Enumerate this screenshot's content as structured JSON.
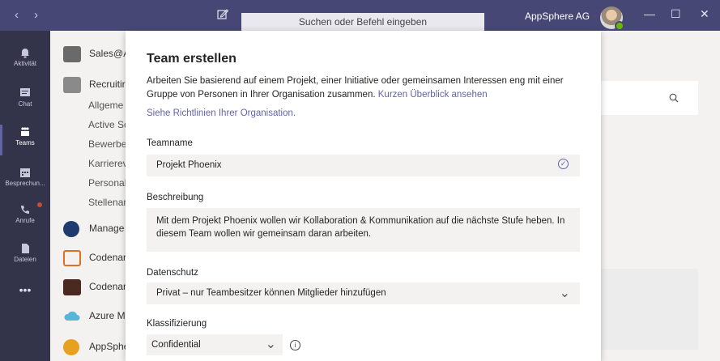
{
  "titlebar": {
    "back": "‹",
    "forward": "›",
    "search_placeholder": "Suchen oder Befehl eingeben",
    "org_name": "AppSphere AG",
    "org_chevron": "⌄",
    "minimize": "—",
    "maximize": "☐",
    "close": "✕"
  },
  "rail": {
    "items": [
      {
        "label": "Aktivität",
        "icon": "bell-icon"
      },
      {
        "label": "Chat",
        "icon": "chat-icon"
      },
      {
        "label": "Teams",
        "icon": "teams-icon"
      },
      {
        "label": "Besprechun...",
        "icon": "calendar-icon"
      },
      {
        "label": "Anrufe",
        "icon": "phone-icon"
      },
      {
        "label": "Dateien",
        "icon": "files-icon"
      },
      {
        "label": "•••",
        "icon": "more-icon"
      }
    ]
  },
  "teams_list": {
    "teams": [
      {
        "name": "Sales@A",
        "icon": "sales-team-icon"
      },
      {
        "name": "Recruitir",
        "icon": "recruiting-team-icon"
      },
      {
        "name": "Manage",
        "icon": "management-team-icon"
      },
      {
        "name": "Codenar",
        "icon": "codename-team-icon"
      },
      {
        "name": "Codenar",
        "icon": "codename2-team-icon"
      },
      {
        "name": "Azure M",
        "icon": "azure-team-icon"
      },
      {
        "name": "AppSphe",
        "icon": "appsphere-team-icon"
      }
    ],
    "channels": [
      "Allgeme",
      "Active Sc",
      "Bewerbe",
      "Karrierev",
      "Personal",
      "Stellenar"
    ]
  },
  "modal": {
    "title": "Team erstellen",
    "intro": "Arbeiten Sie basierend auf einem Projekt, einer Initiative oder gemeinsamen Interessen eng mit einer Gruppe von Personen in Ihrer Organisation zusammen.",
    "intro_link": "Kurzen Überblick ansehen",
    "policy_link": "Siehe Richtlinien Ihrer Organisation.",
    "teamname_label": "Teamname",
    "teamname_value": "Projekt Phoenix",
    "description_label": "Beschreibung",
    "description_value": "Mit dem Projekt Phoenix wollen wir Kollaboration & Kommunikation auf die nächste Stufe heben. In diesem Team wollen wir gemeinsam daran arbeiten.",
    "privacy_label": "Datenschutz",
    "privacy_value": "Privat – nur Teambesitzer können Mitglieder hinzufügen",
    "classification_label": "Klassifizierung",
    "classification_value": "Confidential",
    "check_glyph": "✓",
    "chevron_glyph": "⌄",
    "info_glyph": "i"
  },
  "colors": {
    "titlebar": "#464775",
    "rail": "#33344a",
    "accent": "#6264a7"
  }
}
